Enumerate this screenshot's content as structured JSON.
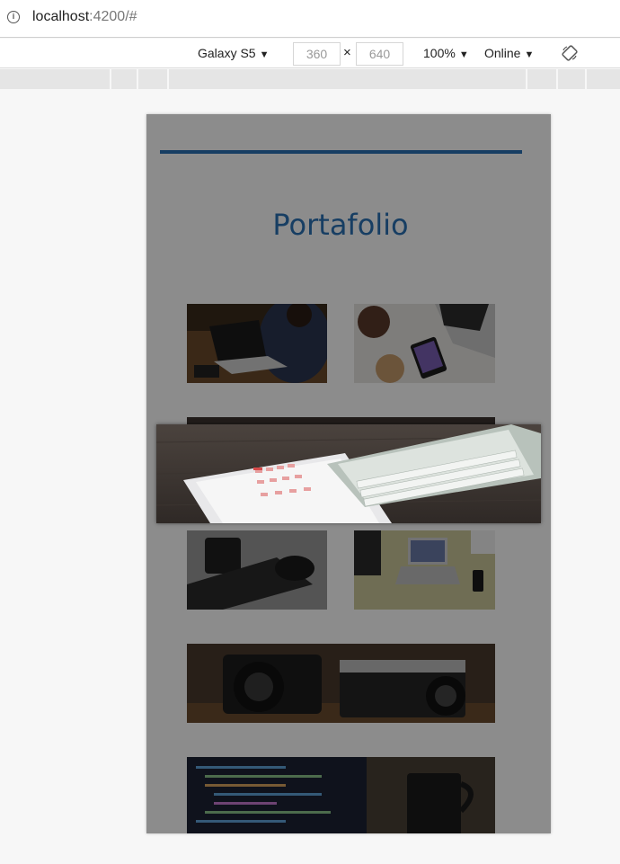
{
  "browser": {
    "url_host": "localhost",
    "url_rest": ":4200/#"
  },
  "device_toolbar": {
    "device": "Galaxy S5",
    "width": "360",
    "height": "640",
    "times": "×",
    "zoom": "100%",
    "network": "Online"
  },
  "page": {
    "title": "Portafolio",
    "accent": "#2a72b5"
  },
  "icons": {
    "info": "info-icon",
    "rotate": "rotate-icon"
  }
}
